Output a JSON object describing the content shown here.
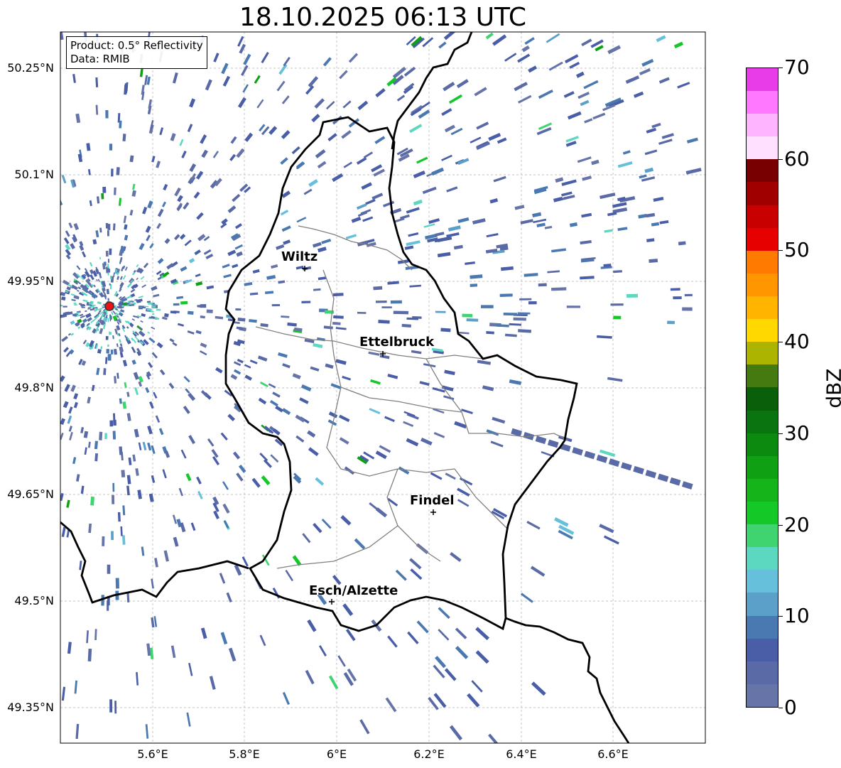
{
  "title": "18.10.2025 06:13 UTC",
  "info": {
    "product": "Product: 0.5° Reflectivity",
    "source": "Data: RMIB"
  },
  "lat_ticks": [
    "50.25°N",
    "50.1°N",
    "49.95°N",
    "49.8°N",
    "49.65°N",
    "49.5°N",
    "49.35°N"
  ],
  "lon_ticks": [
    "5.6°E",
    "5.8°E",
    "6°E",
    "6.2°E",
    "6.4°E",
    "6.6°E"
  ],
  "cities": [
    {
      "name": "Wiltz"
    },
    {
      "name": "Ettelbruck"
    },
    {
      "name": "Findel"
    },
    {
      "name": "Esch/Alzette"
    }
  ],
  "radar_site": {
    "marker_color": "#ee1111"
  },
  "colorbar": {
    "label": "dBZ",
    "ticks": [
      "0",
      "10",
      "20",
      "30",
      "40",
      "50",
      "60",
      "70"
    ],
    "range": [
      0,
      70
    ],
    "colors": [
      "#6674a8",
      "#5a6aa6",
      "#4a5ea8",
      "#4a78b0",
      "#5aa0c8",
      "#66c0dc",
      "#5cd8c0",
      "#40d470",
      "#14c828",
      "#14b41a",
      "#10a014",
      "#0c8a10",
      "#0a7410",
      "#0a600a",
      "#457a10",
      "#adb400",
      "#ffd800",
      "#ffb400",
      "#ff9600",
      "#ff7a00",
      "#e60000",
      "#c80000",
      "#a00000",
      "#780000",
      "#ffe0ff",
      "#ffb4ff",
      "#ff78ff",
      "#e83ce8"
    ]
  },
  "colors": {
    "border_national": "#000000",
    "border_canton": "#808080",
    "grid": "#b0b0b0"
  }
}
